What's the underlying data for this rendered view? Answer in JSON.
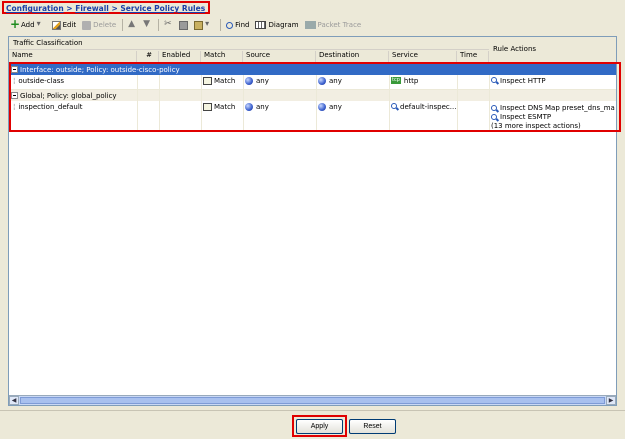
{
  "breadcrumb": {
    "items": [
      "Configuration",
      "Firewall",
      "Service Policy Rules"
    ],
    "separator": ">"
  },
  "toolbar": {
    "add": "Add",
    "edit": "Edit",
    "delete": "Delete",
    "find": "Find",
    "diagram": "Diagram",
    "packet_trace": "Packet Trace"
  },
  "grid": {
    "group_traffic": "Traffic Classification",
    "group_actions": "Rule Actions",
    "columns": {
      "name": "Name",
      "num": "#",
      "enabled": "Enabled",
      "match": "Match",
      "source": "Source",
      "destination": "Destination",
      "service": "Service",
      "time": "Time"
    },
    "sections": [
      {
        "label": "Interface: outside; Policy: outside-cisco-policy",
        "selected": true,
        "rows": [
          {
            "name": "outside-class",
            "match": "Match",
            "source": "any",
            "destination": "any",
            "service": "http",
            "actions": [
              "Inspect HTTP"
            ]
          }
        ]
      },
      {
        "label": "Global; Policy: global_policy",
        "selected": false,
        "rows": [
          {
            "name": "inspection_default",
            "match": "Match",
            "source": "any",
            "destination": "any",
            "service": "default-inspec...",
            "actions": [
              "Inspect DNS Map preset_dns_map",
              "Inspect ESMTP"
            ],
            "more": "(13 more inspect actions)"
          }
        ]
      }
    ]
  },
  "buttons": {
    "apply": "Apply",
    "reset": "Reset"
  },
  "colors": {
    "selection": "#316ac5",
    "highlight_box": "#e00000",
    "link": "#1a3fa8"
  }
}
